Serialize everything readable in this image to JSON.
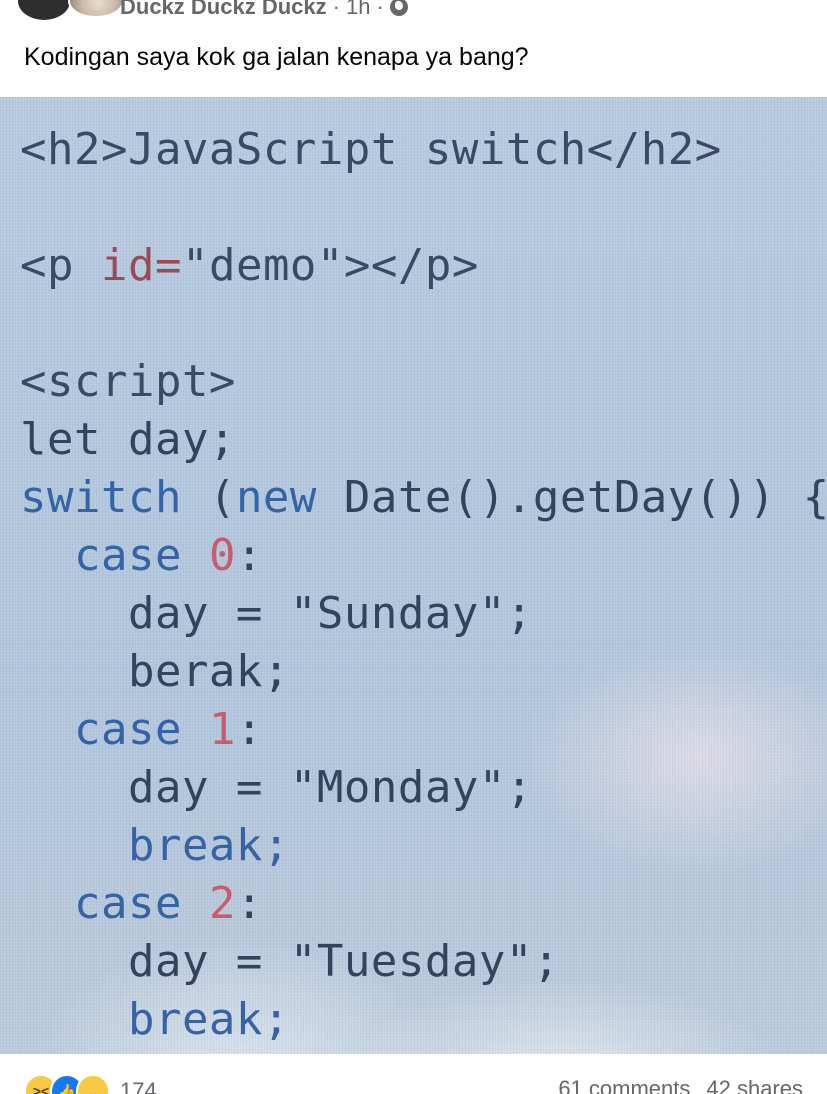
{
  "post": {
    "author": "Duckz Duckz Duckz",
    "separator": "·",
    "time": "1h",
    "separator2": "·",
    "text": "Kodingan saya kok ga jalan kenapa ya bang?"
  },
  "photo": {
    "code_lines": [
      [
        {
          "t": "<h2>JavaScript switch</h2>",
          "c": "tag"
        }
      ],
      [
        {
          "t": "",
          "c": "plain"
        }
      ],
      [
        {
          "t": "<p ",
          "c": "tag"
        },
        {
          "t": "id=",
          "c": "attr"
        },
        {
          "t": "\"demo\"></p>",
          "c": "tag"
        }
      ],
      [
        {
          "t": "",
          "c": "plain"
        }
      ],
      [
        {
          "t": "<script>",
          "c": "tag"
        }
      ],
      [
        {
          "t": "let day;",
          "c": "plain"
        }
      ],
      [
        {
          "t": "switch",
          "c": "kw"
        },
        {
          "t": " (",
          "c": "plain"
        },
        {
          "t": "new",
          "c": "kw"
        },
        {
          "t": " Date().getDay()) {",
          "c": "plain"
        }
      ],
      [
        {
          "t": "  case ",
          "c": "kw"
        },
        {
          "t": "0",
          "c": "num"
        },
        {
          "t": ":",
          "c": "plain"
        }
      ],
      [
        {
          "t": "    day = \"Sunday\";",
          "c": "plain"
        }
      ],
      [
        {
          "t": "    berak;",
          "c": "plain"
        }
      ],
      [
        {
          "t": "  case ",
          "c": "kw"
        },
        {
          "t": "1",
          "c": "num"
        },
        {
          "t": ":",
          "c": "plain"
        }
      ],
      [
        {
          "t": "    day = \"Monday\";",
          "c": "plain"
        }
      ],
      [
        {
          "t": "    break;",
          "c": "kw"
        }
      ],
      [
        {
          "t": "  case ",
          "c": "kw"
        },
        {
          "t": "2",
          "c": "num"
        },
        {
          "t": ":",
          "c": "plain"
        }
      ],
      [
        {
          "t": "    day = \"Tuesday\";",
          "c": "plain"
        }
      ],
      [
        {
          "t": "    break;",
          "c": "kw"
        }
      ]
    ]
  },
  "footer": {
    "reactions": [
      "haha-icon",
      "like-icon",
      "sad-icon"
    ],
    "reaction_count": "174",
    "comments": "61 comments",
    "shares": "42 shares"
  },
  "colors": {
    "tag": "#3b4a64",
    "attr": "#9a4a57",
    "keyword": "#3463a6",
    "number": "#c75d6a",
    "plain": "#33435c",
    "photo_bg": "#b4c8de",
    "like_blue": "#1877f2"
  }
}
